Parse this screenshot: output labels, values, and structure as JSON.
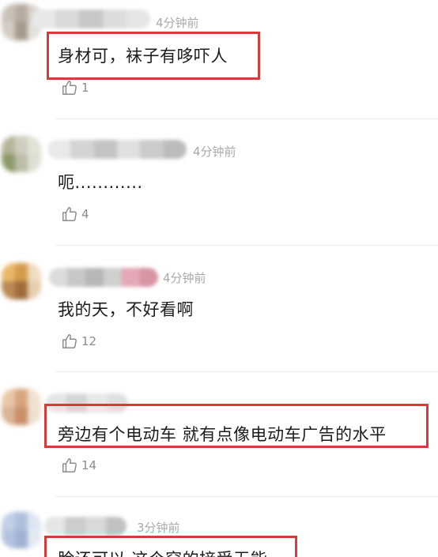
{
  "comments": [
    {
      "time": "4分钟前",
      "text": "身材可，袜子有哆吓人",
      "likes": "1",
      "highlighted": true
    },
    {
      "time": "4分钟前",
      "text": "呃............",
      "likes": "4",
      "highlighted": false
    },
    {
      "time": "4分钟前",
      "text": "我的天，不好看啊",
      "likes": "12",
      "highlighted": false
    },
    {
      "time": "",
      "text": "旁边有个电动车 就有点像电动车广告的水平",
      "likes": "14",
      "highlighted": true
    },
    {
      "time": "3分钟前",
      "text": "脸还可以 这个穿的接受无能",
      "likes": "",
      "highlighted": true
    }
  ],
  "icons": {
    "like": "thumbs-up-icon"
  },
  "colors": {
    "highlight_border": "#d63a3a",
    "timestamp": "#a9a9a9",
    "like_count": "#8c8c8c"
  }
}
